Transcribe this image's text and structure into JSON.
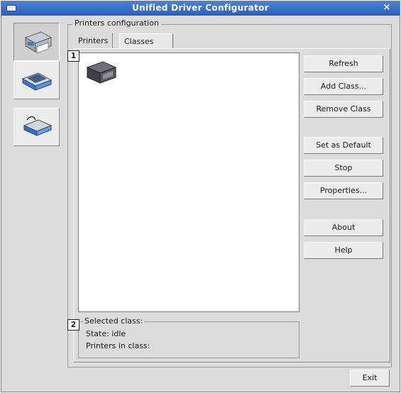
{
  "window": {
    "title": "Unified Driver Configurator",
    "close_glyph": "×"
  },
  "sidebar": {
    "items": [
      {
        "name": "printers",
        "icon": "printer-icon",
        "active": true
      },
      {
        "name": "scanners",
        "icon": "scanner-icon",
        "active": false
      },
      {
        "name": "ports",
        "icon": "port-icon",
        "active": false
      }
    ]
  },
  "config": {
    "group_title": "Printers configuration",
    "tabs": [
      {
        "label": "Printers",
        "active": false
      },
      {
        "label": "Classes",
        "active": true
      }
    ]
  },
  "callouts": {
    "list": "1",
    "selected": "2"
  },
  "buttons": {
    "refresh": "Refresh",
    "add_class": "Add Class...",
    "remove_class": "Remove Class",
    "set_default": "Set as Default",
    "stop": "Stop",
    "properties": "Properties...",
    "about": "About",
    "help": "Help",
    "exit": "Exit"
  },
  "selected_class": {
    "title": "Selected class:",
    "state": "State: idle",
    "printers_in_class": "Printers in class:"
  },
  "colors": {
    "titlebar": "#2a5fb8",
    "window_bg": "#dcdcdc"
  }
}
